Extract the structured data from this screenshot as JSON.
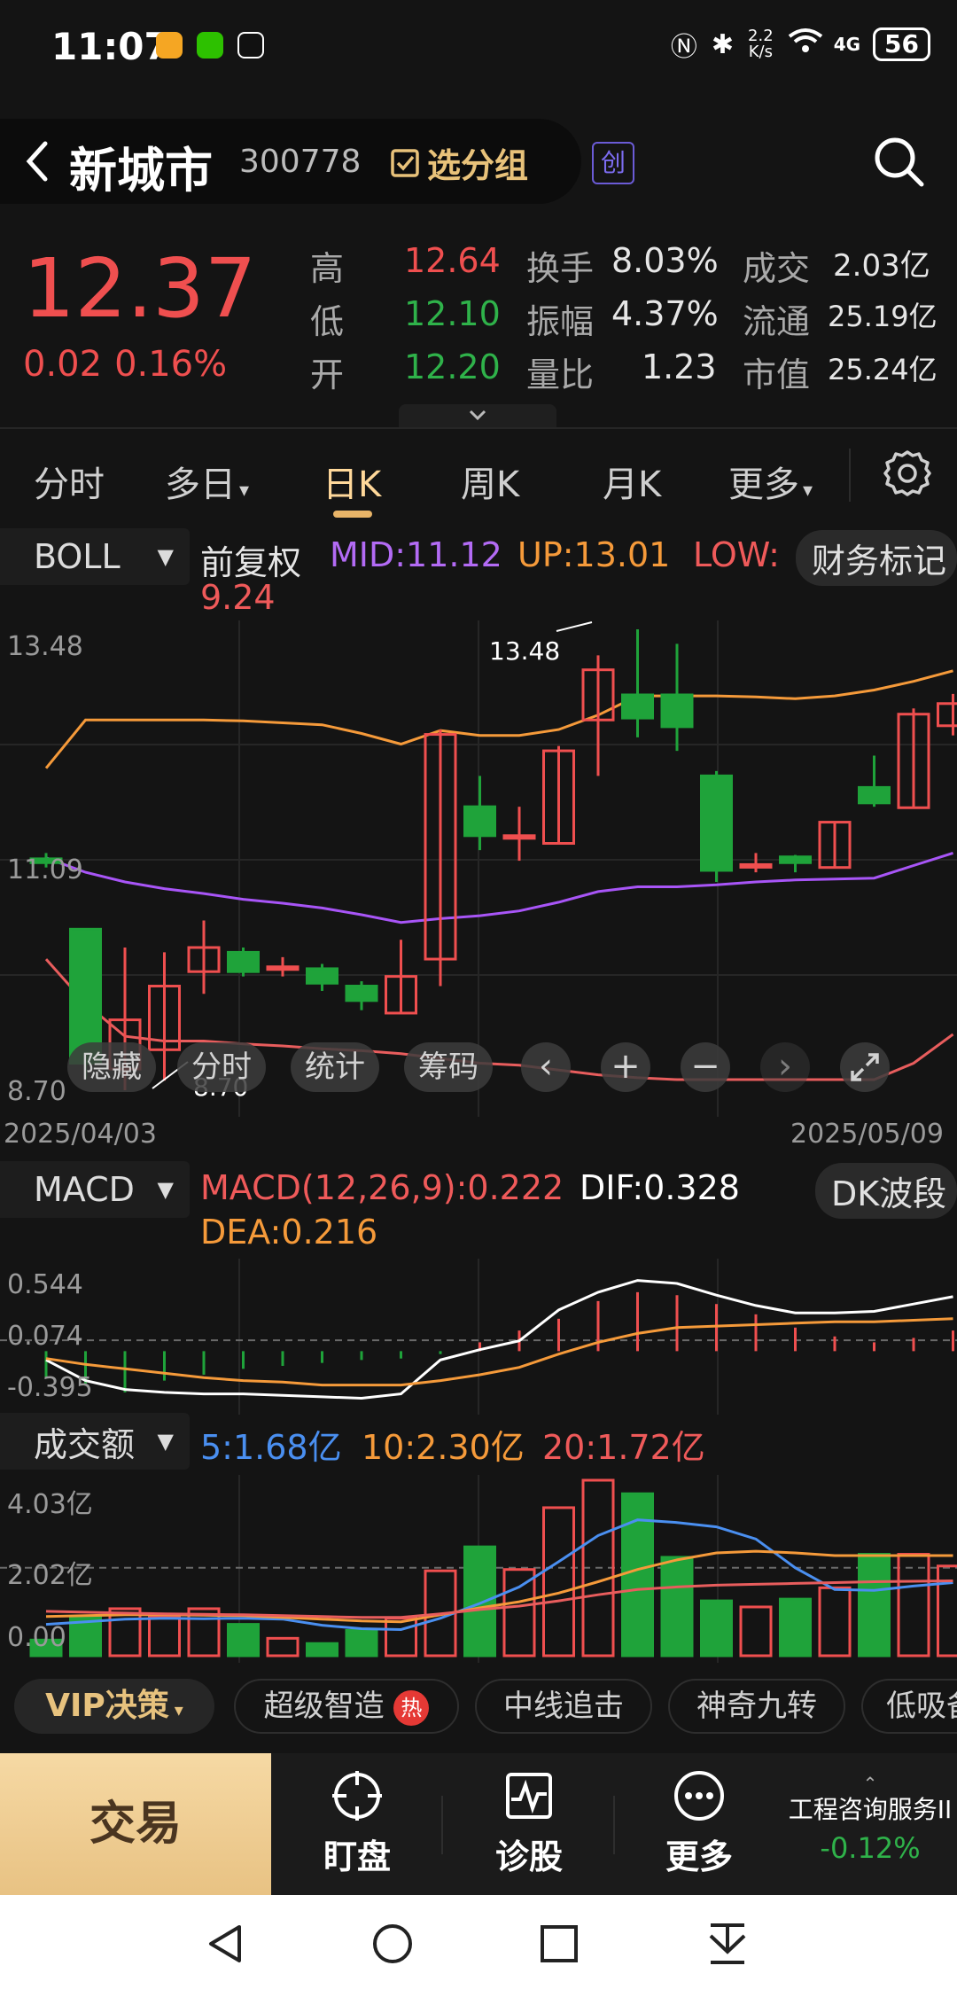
{
  "status_bar": {
    "time": "11:07",
    "net_speed_top": "2.2",
    "net_speed_unit": "K/s",
    "signal": "4G",
    "battery": "56"
  },
  "header": {
    "back_icon": "chevron-left-icon",
    "name": "新城市",
    "code": "300778",
    "group_button": "选分组",
    "board_badge": "创",
    "search_icon": "search-icon"
  },
  "quote": {
    "price": "12.37",
    "change": "0.02",
    "change_pct": "0.16%",
    "high_label": "高",
    "high": "12.64",
    "low_label": "低",
    "low": "12.10",
    "open_label": "开",
    "open": "12.20",
    "turnover_label": "换手",
    "turnover": "8.03%",
    "amplitude_label": "振幅",
    "amplitude": "4.37%",
    "volume_ratio_label": "量比",
    "volume_ratio": "1.23",
    "amount_label": "成交",
    "amount": "2.03亿",
    "float_label": "流通",
    "float_cap": "25.19亿",
    "mcap_label": "市值",
    "mcap": "25.24亿"
  },
  "period_tabs": [
    {
      "label": "分时"
    },
    {
      "label": "多日"
    },
    {
      "label": "日K",
      "active": true
    },
    {
      "label": "周K"
    },
    {
      "label": "月K"
    },
    {
      "label": "更多"
    }
  ],
  "boll_bar": {
    "indicator": "BOLL",
    "adjust": "前复权",
    "mid": "MID:11.12",
    "up": "UP:13.01",
    "low": "LOW:",
    "low_value": "9.24",
    "finance_mark": "财务标记"
  },
  "kline_axis": {
    "y_top": "13.48",
    "y_mid": "11.09",
    "y_bottom": "8.70",
    "max_marker": "13.48",
    "min_marker": "8.70",
    "date_start": "2025/04/03",
    "date_end": "2025/05/09"
  },
  "chart_controls": {
    "hide": "隐藏",
    "intraday": "分时",
    "stats": "统计",
    "chips": "筹码",
    "prev_icon": "chevron-left-icon",
    "zoom_in": "+",
    "zoom_out": "−",
    "next_icon": "chevron-right-icon",
    "fullscreen_icon": "fullscreen-icon"
  },
  "macd_bar": {
    "indicator": "MACD",
    "macd": "MACD(12,26,9):0.222",
    "dif": "DIF:0.328",
    "dea": "DEA:0.216",
    "wave_button": "DK波段",
    "y_top": "0.544",
    "y_mid": "0.074",
    "y_bottom": "-0.395"
  },
  "volume_bar": {
    "indicator": "成交额",
    "ma5": "5:1.68亿",
    "ma10": "10:2.30亿",
    "ma20": "20:1.72亿",
    "y_top": "4.03亿",
    "y_mid": "2.02亿",
    "y_bottom": "0.00"
  },
  "feature_strip": [
    {
      "label": "VIP决策"
    },
    {
      "label": "超级智造",
      "hot": "热"
    },
    {
      "label": "中线追击"
    },
    {
      "label": "神奇九转"
    },
    {
      "label": "低吸备"
    }
  ],
  "action_bar": {
    "trade": "交易",
    "watch": "盯盘",
    "diagnose": "诊股",
    "more": "更多",
    "sector_name": "工程咨询服务II",
    "sector_change": "-0.12%"
  },
  "colors": {
    "up": "#ef4f4f",
    "down": "#1fa33a",
    "mid_line": "#a855f7",
    "upper_line": "#f59a3a",
    "lower_line": "#e85d5d",
    "dif_line": "#ffffff",
    "dea_line": "#f59a3a",
    "ma5_line": "#4a8ff0"
  },
  "chart_data": [
    {
      "type": "candlestick",
      "title": "BOLL",
      "ylim": [
        8.7,
        13.48
      ],
      "candles": [
        {
          "o": 11.1,
          "h": 11.16,
          "l": 11.01,
          "c": 11.06
        },
        {
          "o": 10.37,
          "h": 10.37,
          "l": 8.82,
          "c": 8.98
        },
        {
          "o": 8.92,
          "h": 10.18,
          "l": 8.7,
          "c": 9.43
        },
        {
          "o": 9.12,
          "h": 10.13,
          "l": 8.8,
          "c": 9.78
        },
        {
          "o": 9.93,
          "h": 10.46,
          "l": 9.7,
          "c": 10.18
        },
        {
          "o": 10.13,
          "h": 10.18,
          "l": 9.88,
          "c": 9.93
        },
        {
          "o": 9.98,
          "h": 10.08,
          "l": 9.88,
          "c": 9.98
        },
        {
          "o": 9.96,
          "h": 10.01,
          "l": 9.73,
          "c": 9.81
        },
        {
          "o": 9.78,
          "h": 9.83,
          "l": 9.53,
          "c": 9.63
        },
        {
          "o": 9.5,
          "h": 10.26,
          "l": 9.5,
          "c": 9.88
        },
        {
          "o": 10.06,
          "h": 12.44,
          "l": 9.78,
          "c": 12.39
        },
        {
          "o": 11.64,
          "h": 11.96,
          "l": 11.19,
          "c": 11.34
        },
        {
          "o": 11.34,
          "h": 11.64,
          "l": 11.08,
          "c": 11.34
        },
        {
          "o": 11.26,
          "h": 12.27,
          "l": 11.26,
          "c": 12.22
        },
        {
          "o": 12.54,
          "h": 13.21,
          "l": 11.96,
          "c": 13.06
        },
        {
          "o": 12.8,
          "h": 13.48,
          "l": 12.36,
          "c": 12.56
        },
        {
          "o": 12.8,
          "h": 13.33,
          "l": 12.22,
          "c": 12.47
        },
        {
          "o": 11.96,
          "h": 12.01,
          "l": 10.86,
          "c": 10.98
        },
        {
          "o": 11.04,
          "h": 11.16,
          "l": 10.96,
          "c": 11.04
        },
        {
          "o": 11.12,
          "h": 11.14,
          "l": 10.96,
          "c": 11.06
        },
        {
          "o": 11.01,
          "h": 11.48,
          "l": 11.01,
          "c": 11.48
        },
        {
          "o": 11.84,
          "h": 12.17,
          "l": 11.64,
          "c": 11.68
        },
        {
          "o": 11.63,
          "h": 12.66,
          "l": 11.63,
          "c": 12.6
        },
        {
          "o": 12.48,
          "h": 12.81,
          "l": 12.38,
          "c": 12.71
        }
      ],
      "series": [
        {
          "name": "UP",
          "values": [
            12.04,
            12.54,
            12.54,
            12.54,
            12.54,
            12.53,
            12.51,
            12.49,
            12.4,
            12.29,
            12.43,
            12.38,
            12.38,
            12.44,
            12.59,
            12.79,
            12.79,
            12.79,
            12.78,
            12.76,
            12.79,
            12.85,
            12.94,
            13.05
          ]
        },
        {
          "name": "MID",
          "values": [
            11.11,
            10.96,
            10.86,
            10.79,
            10.74,
            10.68,
            10.64,
            10.59,
            10.52,
            10.44,
            10.48,
            10.51,
            10.56,
            10.65,
            10.76,
            10.81,
            10.81,
            10.83,
            10.86,
            10.88,
            10.89,
            10.9,
            11.03,
            11.16
          ]
        },
        {
          "name": "LOW",
          "values": [
            10.06,
            9.6,
            9.26,
            9.21,
            9.21,
            9.18,
            9.16,
            9.13,
            9.11,
            9.08,
            9.03,
            8.98,
            8.96,
            8.91,
            8.86,
            8.83,
            8.81,
            8.81,
            8.81,
            8.81,
            8.81,
            8.81,
            8.98,
            9.28
          ]
        }
      ]
    },
    {
      "type": "bar",
      "title": "MACD",
      "ylim": [
        -0.395,
        0.544
      ],
      "values": [
        -0.18,
        -0.22,
        -0.28,
        -0.2,
        -0.16,
        -0.12,
        -0.1,
        -0.08,
        -0.06,
        -0.05,
        -0.02,
        0.06,
        0.14,
        0.22,
        0.34,
        0.4,
        0.38,
        0.32,
        0.25,
        0.16,
        0.1,
        0.06,
        0.09,
        0.14
      ],
      "series": [
        {
          "name": "DIF",
          "values": [
            -0.06,
            -0.2,
            -0.26,
            -0.28,
            -0.29,
            -0.29,
            -0.3,
            -0.31,
            -0.32,
            -0.29,
            -0.06,
            0.01,
            0.07,
            0.28,
            0.4,
            0.48,
            0.46,
            0.38,
            0.31,
            0.26,
            0.26,
            0.27,
            0.32,
            0.37
          ]
        },
        {
          "name": "DEA",
          "values": [
            -0.05,
            -0.09,
            -0.12,
            -0.15,
            -0.18,
            -0.2,
            -0.21,
            -0.23,
            -0.23,
            -0.23,
            -0.2,
            -0.16,
            -0.11,
            -0.02,
            0.06,
            0.12,
            0.16,
            0.17,
            0.18,
            0.19,
            0.2,
            0.2,
            0.21,
            0.22
          ]
        }
      ]
    },
    {
      "type": "bar",
      "title": "成交额",
      "ylim": [
        0,
        4.03
      ],
      "values": [
        0.36,
        0.88,
        1.08,
        0.9,
        1.08,
        0.72,
        0.4,
        0.28,
        0.58,
        0.86,
        1.95,
        2.5,
        1.98,
        3.4,
        4.03,
        3.72,
        2.26,
        1.26,
        1.12,
        1.3,
        1.56,
        2.33,
        2.33,
        2.06
      ],
      "series": [
        {
          "name": "5",
          "values": [
            0.72,
            0.78,
            0.84,
            0.86,
            0.85,
            0.86,
            0.84,
            0.7,
            0.62,
            0.6,
            0.86,
            1.2,
            1.58,
            2.16,
            2.76,
            3.12,
            3.06,
            2.96,
            2.68,
            2.02,
            1.52,
            1.5,
            1.6,
            1.68
          ]
        },
        {
          "name": "10",
          "values": [
            0.9,
            0.92,
            0.94,
            0.94,
            0.93,
            0.92,
            0.88,
            0.84,
            0.8,
            0.78,
            0.94,
            1.1,
            1.24,
            1.44,
            1.7,
            1.98,
            2.2,
            2.36,
            2.4,
            2.36,
            2.3,
            2.3,
            2.3,
            2.3
          ]
        },
        {
          "name": "20",
          "values": [
            1.02,
            1.0,
            0.98,
            0.96,
            0.95,
            0.94,
            0.92,
            0.9,
            0.88,
            0.88,
            0.96,
            1.06,
            1.14,
            1.26,
            1.4,
            1.52,
            1.58,
            1.62,
            1.64,
            1.66,
            1.68,
            1.7,
            1.71,
            1.72
          ]
        }
      ]
    }
  ]
}
